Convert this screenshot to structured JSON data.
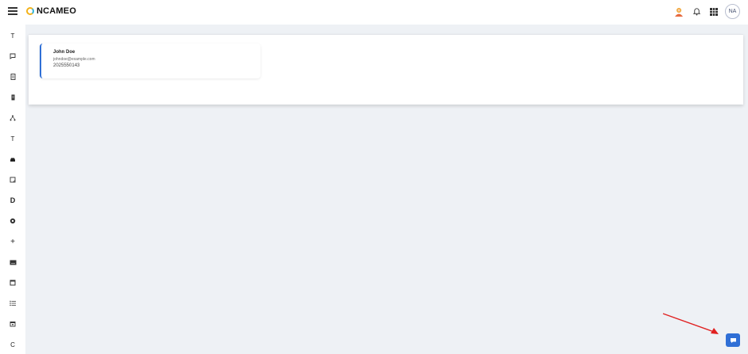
{
  "app": {
    "brand_name": "NCAMEO",
    "colors": {
      "accent": "#2f6fd6",
      "logo_yellow": "#f3b21a",
      "logo_blue": "#33b3d6",
      "annotation_arrow": "#e02020"
    }
  },
  "header": {
    "user_initials": "NA",
    "icons": [
      "menu-icon",
      "profile-illustration-icon",
      "bell-icon",
      "grid-icon"
    ]
  },
  "sidebar": {
    "items": [
      {
        "label": "T",
        "icon": "t-letter-icon"
      },
      {
        "label": "▢",
        "icon": "chat-bubble-icon"
      },
      {
        "label": "≣",
        "icon": "document-icon"
      },
      {
        "label": "≣",
        "icon": "file-stack-icon"
      },
      {
        "label": "⁂",
        "icon": "network-icon"
      },
      {
        "label": "T",
        "icon": "text-icon"
      },
      {
        "label": "●",
        "icon": "car-icon"
      },
      {
        "label": "▢",
        "icon": "note-icon"
      },
      {
        "label": "D",
        "icon": "d-letter-icon"
      },
      {
        "label": "◉",
        "icon": "globe-icon"
      },
      {
        "label": "+",
        "icon": "plus-icon"
      },
      {
        "label": "■",
        "icon": "keyboard-icon"
      },
      {
        "label": "▭",
        "icon": "window-icon"
      },
      {
        "label": "☰",
        "icon": "list-icon"
      },
      {
        "label": "▣",
        "icon": "calendar-icon"
      },
      {
        "label": "C",
        "icon": "c-letter-icon"
      }
    ]
  },
  "contact": {
    "name": "John Doe",
    "email": "johndoe@example.com",
    "phone": "2025550143"
  },
  "widget": {
    "icon": "chat-icon"
  }
}
